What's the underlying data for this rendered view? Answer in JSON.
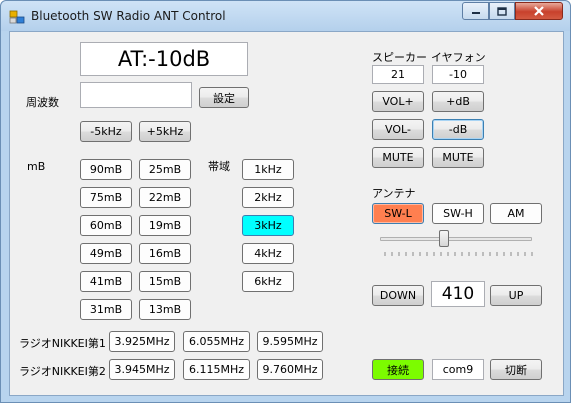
{
  "window": {
    "title": "Bluetooth SW Radio ANT Control"
  },
  "attenuation": {
    "display": "AT:-10dB"
  },
  "frequency": {
    "label": "周波数",
    "input_value": "",
    "set_button": "設定",
    "minus_5k": "-5kHz",
    "plus_5k": "+5kHz"
  },
  "meter_band": {
    "label": "mB",
    "buttons": [
      [
        "90mB",
        "25mB"
      ],
      [
        "75mB",
        "22mB"
      ],
      [
        "60mB",
        "19mB"
      ],
      [
        "49mB",
        "16mB"
      ],
      [
        "41mB",
        "15mB"
      ],
      [
        "31mB",
        "13mB"
      ]
    ]
  },
  "bandwidth": {
    "label": "帯域",
    "options": [
      "1kHz",
      "2kHz",
      "3kHz",
      "4kHz",
      "6kHz"
    ],
    "selected": "3kHz"
  },
  "nikkei": {
    "row1": {
      "label": "ラジオNIKKEI第1",
      "freqs": [
        "3.925MHz",
        "6.055MHz",
        "9.595MHz"
      ]
    },
    "row2": {
      "label": "ラジオNIKKEI第2",
      "freqs": [
        "3.945MHz",
        "6.115MHz",
        "9.760MHz"
      ]
    }
  },
  "audio": {
    "speaker_label": "スピーカー",
    "earphone_label": "イヤフォン",
    "speaker_value": "21",
    "earphone_value": "-10",
    "vol_up": "VOL+",
    "vol_down": "VOL-",
    "db_up": "+dB",
    "db_down": "-dB",
    "speaker_mute": "MUTE",
    "earphone_mute": "MUTE"
  },
  "antenna": {
    "label": "アンテナ",
    "options": [
      "SW-L",
      "SW-H",
      "AM"
    ],
    "selected": "SW-L",
    "slider_level_fraction": 0.42
  },
  "tuning": {
    "down": "DOWN",
    "value": "410",
    "up": "UP"
  },
  "connection": {
    "connect": "接続",
    "port": "com9",
    "disconnect": "切断"
  },
  "colors": {
    "selected_band": "#00ffff",
    "selected_antenna": "#ff7f50",
    "connected": "#7cfc00"
  }
}
